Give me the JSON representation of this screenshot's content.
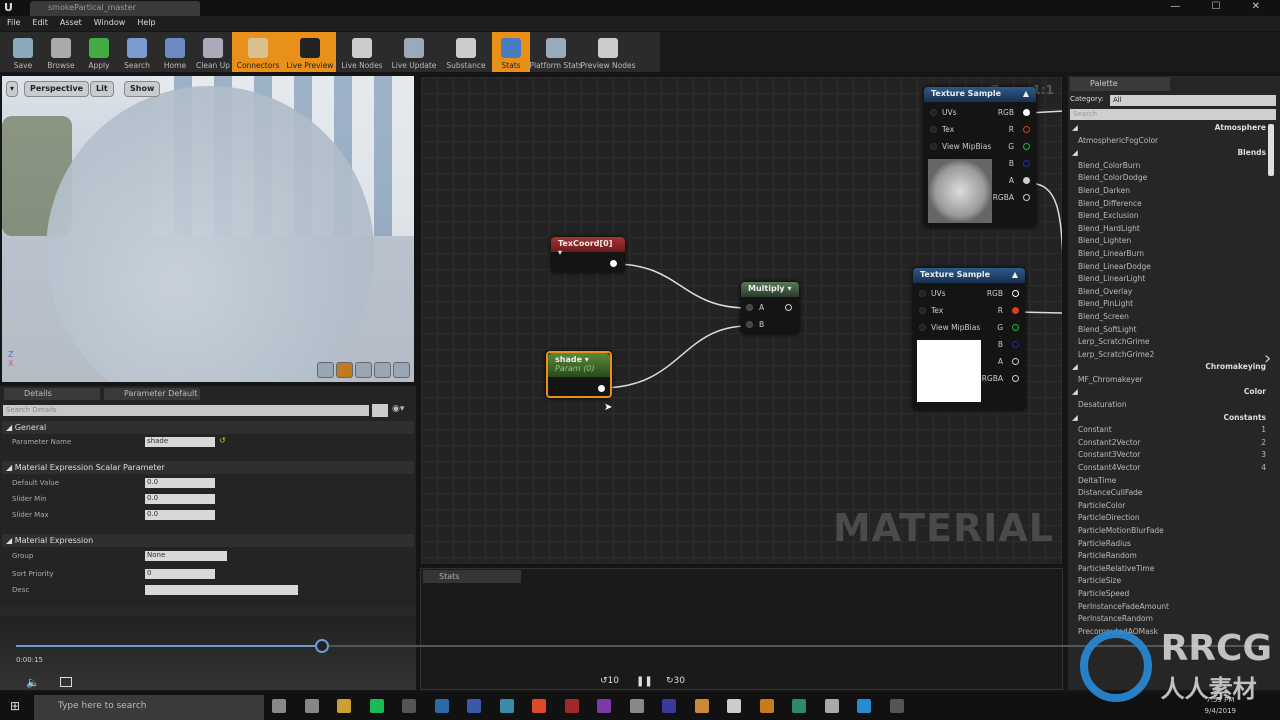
{
  "window": {
    "logo": "U",
    "tab": "smokePartical_master",
    "controls": "— ☐ ✕"
  },
  "menu": [
    "File",
    "Edit",
    "Asset",
    "Window",
    "Help"
  ],
  "toolbar": [
    {
      "label": "Save",
      "active": false,
      "icon": "save-icon"
    },
    {
      "label": "Browse",
      "active": false,
      "icon": "browse-icon"
    },
    {
      "label": "Apply",
      "active": false,
      "icon": "apply-icon"
    },
    {
      "label": "Search",
      "active": false,
      "icon": "search-icon"
    },
    {
      "label": "Home",
      "active": false,
      "icon": "home-icon"
    },
    {
      "label": "Clean Up",
      "active": false,
      "icon": "cleanup-icon"
    },
    {
      "label": "Connectors",
      "active": true,
      "icon": "connectors-icon"
    },
    {
      "label": "Live Preview",
      "active": true,
      "icon": "live-preview-icon"
    },
    {
      "label": "Live Nodes",
      "active": false,
      "icon": "live-nodes-icon"
    },
    {
      "label": "Live Update",
      "active": false,
      "icon": "live-update-icon"
    },
    {
      "label": "Substance",
      "active": false,
      "icon": "substance-icon"
    },
    {
      "label": "Stats",
      "active": true,
      "icon": "stats-icon"
    },
    {
      "label": "Platform Stats",
      "active": false,
      "icon": "platform-stats-icon"
    },
    {
      "label": "Preview Nodes",
      "active": false,
      "icon": "preview-nodes-icon"
    }
  ],
  "viewport": {
    "perspective": "Perspective",
    "lit": "Lit",
    "show": "Show",
    "axis_z": "Z",
    "axis_x": "X"
  },
  "details": {
    "tabs": [
      "Details",
      "Parameter Default"
    ],
    "search_placeholder": "Search Details",
    "sections": {
      "general": "General",
      "scalar": "Material Expression Scalar Parameter",
      "expr": "Material Expression"
    },
    "parameter_name_label": "Parameter Name",
    "parameter_name": "shade",
    "default_value_label": "Default Value",
    "default_value": "0.0",
    "slider_min_label": "Slider Min",
    "slider_min": "0.0",
    "slider_max_label": "Slider Max",
    "slider_max": "0.0",
    "group_label": "Group",
    "group": "None",
    "sort_priority_label": "Sort Priority",
    "sort_priority": "0",
    "desc_label": "Desc",
    "desc": ""
  },
  "graph": {
    "zoom": "Zoom 1:1",
    "watermark": "MATERIAL",
    "texcoord": {
      "title": "TexCoord[0]"
    },
    "shade": {
      "title": "shade",
      "subtitle": "Param (0)"
    },
    "multiply": {
      "title": "Multiply",
      "a": "A",
      "b": "B"
    },
    "texsample": {
      "title": "Texture Sample",
      "inputs": [
        "UVs",
        "Tex",
        "View MipBias"
      ],
      "outputs": [
        "RGB",
        "R",
        "G",
        "B",
        "A",
        "RGBA"
      ]
    }
  },
  "stats": {
    "tab": "Stats"
  },
  "palette": {
    "tab": "Palette",
    "category_label": "Category:",
    "category": "All",
    "search_placeholder": "Search",
    "items": [
      {
        "t": "Atmosphere",
        "cat": true
      },
      {
        "t": "AtmosphericFogColor"
      },
      {
        "t": "Blends",
        "cat": true
      },
      {
        "t": "Blend_ColorBurn"
      },
      {
        "t": "Blend_ColorDodge"
      },
      {
        "t": "Blend_Darken"
      },
      {
        "t": "Blend_Difference"
      },
      {
        "t": "Blend_Exclusion"
      },
      {
        "t": "Blend_HardLight"
      },
      {
        "t": "Blend_Lighten"
      },
      {
        "t": "Blend_LinearBurn"
      },
      {
        "t": "Blend_LinearDodge"
      },
      {
        "t": "Blend_LinearLight"
      },
      {
        "t": "Blend_Overlay"
      },
      {
        "t": "Blend_PinLight"
      },
      {
        "t": "Blend_Screen"
      },
      {
        "t": "Blend_SoftLight"
      },
      {
        "t": "Lerp_ScratchGrime"
      },
      {
        "t": "Lerp_ScratchGrime2"
      },
      {
        "t": "Chromakeying",
        "cat": true
      },
      {
        "t": "MF_Chromakeyer"
      },
      {
        "t": "Color",
        "cat": true
      },
      {
        "t": "Desaturation"
      },
      {
        "t": "Constants",
        "cat": true
      },
      {
        "t": "Constant",
        "k": "1"
      },
      {
        "t": "Constant2Vector",
        "k": "2"
      },
      {
        "t": "Constant3Vector",
        "k": "3"
      },
      {
        "t": "Constant4Vector",
        "k": "4"
      },
      {
        "t": "DeltaTime"
      },
      {
        "t": "DistanceCullFade"
      },
      {
        "t": "ParticleColor"
      },
      {
        "t": "ParticleDirection"
      },
      {
        "t": "ParticleMotionBlurFade"
      },
      {
        "t": "ParticleRadius"
      },
      {
        "t": "ParticleRandom"
      },
      {
        "t": "ParticleRelativeTime"
      },
      {
        "t": "ParticleSize"
      },
      {
        "t": "ParticleSpeed"
      },
      {
        "t": "PerInstanceFadeAmount"
      },
      {
        "t": "PerInstanceRandom"
      },
      {
        "t": "PrecomputedAOMask"
      }
    ]
  },
  "player": {
    "time": "0:00:15",
    "progress_fraction": 0.245,
    "rewind": "10",
    "forward": "30"
  },
  "taskbar": {
    "search_placeholder": "Type here to search",
    "time": "7:59 PM",
    "date": "9/4/2019"
  },
  "watermark": {
    "text": "RRCG",
    "sub": "人人素材"
  },
  "colors": {
    "accent": "#e8901a",
    "pin_r": "#e03a1a",
    "pin_g": "#2ab03a",
    "pin_b": "#1a2aa8",
    "seek": "#6b9bd0"
  }
}
